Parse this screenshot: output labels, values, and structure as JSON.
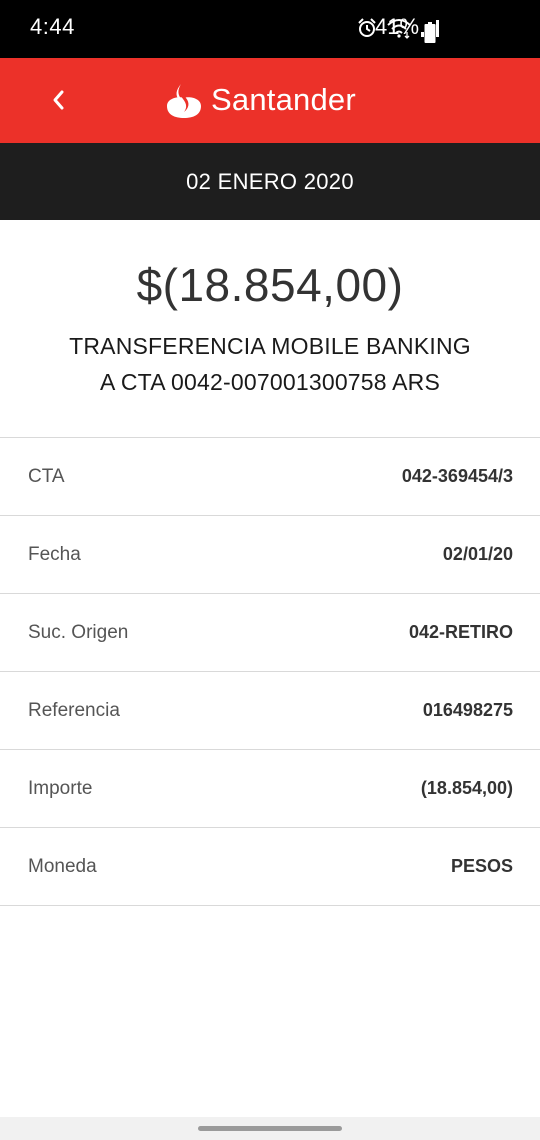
{
  "status_bar": {
    "time": "4:44",
    "battery": "41%",
    "icons": [
      "alarm-icon",
      "wifi-icon",
      "signal-icon",
      "battery-icon"
    ]
  },
  "header": {
    "brand": "Santander",
    "back_icon": "chevron-left-icon",
    "color": "#ec3129"
  },
  "date_band": {
    "date": "02 ENERO 2020"
  },
  "summary": {
    "amount": "$(18.854,00)",
    "description_line1": "TRANSFERENCIA MOBILE BANKING",
    "description_line2": "A CTA 0042-007001300758 ARS"
  },
  "details": [
    {
      "label": "CTA",
      "value": "042-369454/3"
    },
    {
      "label": "Fecha",
      "value": "02/01/20"
    },
    {
      "label": "Suc. Origen",
      "value": "042-RETIRO"
    },
    {
      "label": "Referencia",
      "value": "016498275"
    },
    {
      "label": "Importe",
      "value": "(18.854,00)"
    },
    {
      "label": "Moneda",
      "value": "PESOS"
    }
  ]
}
